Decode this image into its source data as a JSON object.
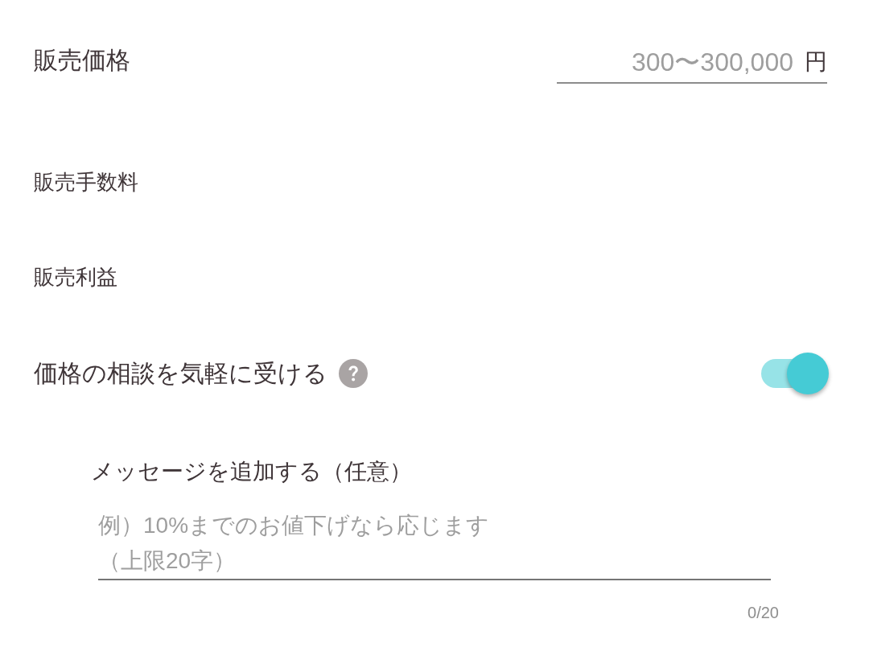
{
  "price": {
    "label": "販売価格",
    "placeholder": "300〜300,000",
    "unit": "円"
  },
  "fee": {
    "label": "販売手数料"
  },
  "profit": {
    "label": "販売利益"
  },
  "negotiation": {
    "label": "価格の相談を気軽に受ける",
    "on": true
  },
  "message": {
    "label": "メッセージを追加する（任意）",
    "placeholder": "例）10%までのお値下げなら応じます（上限20字）",
    "counter": "0/20"
  }
}
